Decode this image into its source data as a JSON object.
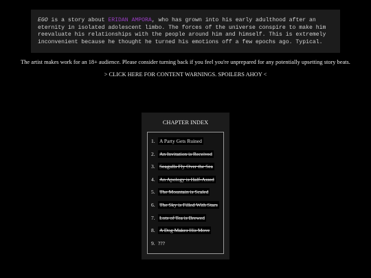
{
  "intro": {
    "ego": "EGO",
    "t1": " is a story about ",
    "character": "ERIDAN AMPORA",
    "t2": ", who has grown into his early adulthood after an eternity in isolated adolescent limbo. The forces of the universe conspire to make him reevaluate his relationships with the people around him and himself. This is extremely inconvenient because he thought he turned his emotions off a few epochs ago. Typical."
  },
  "notice": "The artist makes work for an 18+ audience. Please consider turning back if you feel you're unprepared for any potentially upsetting story beats.",
  "content_warnings_link": "> CLICK HERE FOR CONTENT WARNINGS. SPOILERS AHOY <",
  "chapter_index": {
    "title": "CHAPTER INDEX",
    "chapters": [
      {
        "num": "1.",
        "title": "A Party Gets Ruined"
      },
      {
        "num": "2.",
        "title": "An Invitation is Received"
      },
      {
        "num": "3.",
        "title": "Seagulls Fly Over the Sea"
      },
      {
        "num": "4.",
        "title": "An Apology is Half-Assed"
      },
      {
        "num": "5.",
        "title": "The Mountain is Scaled"
      },
      {
        "num": "6.",
        "title": "The Sky is Filled With Stars"
      },
      {
        "num": "7.",
        "title": "Lots of Tea is Brewed"
      },
      {
        "num": "8.",
        "title": "A Dog Makes His Move"
      },
      {
        "num": "9.",
        "title": "???"
      }
    ]
  },
  "colors": {
    "background": "#000000",
    "panel": "#1c1c1c",
    "character_name": "#9a3fc4"
  }
}
